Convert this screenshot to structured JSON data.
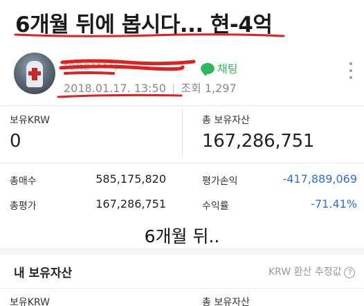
{
  "title": "6개월 뒤에 봅시다... 현-4억",
  "post": {
    "nickname": "rene****)",
    "chat_label": "채팅",
    "date": "2018.01.17. 13:50",
    "views_label": "조회",
    "views": "1,297"
  },
  "holdings_before": {
    "krw_label": "보유KRW",
    "krw_value": "0",
    "total_label": "총 보유자산",
    "total_value": "167,286,751",
    "rows": [
      {
        "label": "총매수",
        "value": "585,175,820",
        "label2": "평가손익",
        "value2": "-417,889,069"
      },
      {
        "label": "총평가",
        "value": "167,286,751",
        "label2": "수익률",
        "value2": "-71.41%"
      }
    ]
  },
  "caption": "6개월 뒤..",
  "holdings_after": {
    "section_title": "내 보유자산",
    "krw_estimate_label": "KRW 환산 추정값",
    "help_icon": "?",
    "krw_label": "보유KRW",
    "total_label": "총 보유자산"
  },
  "colors": {
    "chat_green": "#2eb85c",
    "negative_blue": "#2b6fd6",
    "annotation_red": "#e02020"
  }
}
